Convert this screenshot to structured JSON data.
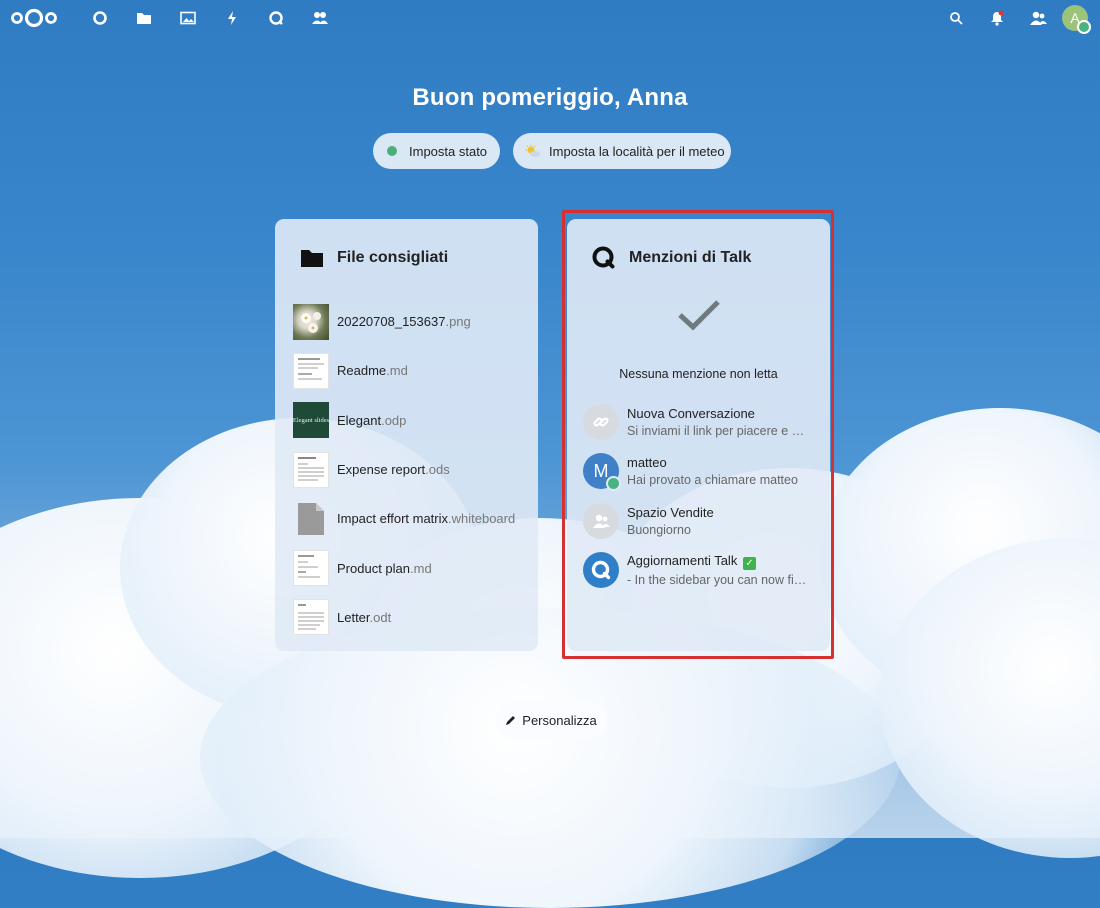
{
  "header": {
    "nav": [
      {
        "id": "dashboard",
        "icon": "dashboard-circle-icon"
      },
      {
        "id": "files",
        "icon": "folder-icon"
      },
      {
        "id": "photos",
        "icon": "image-icon"
      },
      {
        "id": "activity",
        "icon": "lightning-icon"
      },
      {
        "id": "talk",
        "icon": "talk-icon"
      },
      {
        "id": "contacts",
        "icon": "contacts-icon"
      }
    ],
    "right": [
      "search-icon",
      "notifications-icon",
      "contacts-menu-icon"
    ],
    "avatar_initial": "A"
  },
  "greeting": "Buon pomeriggio, Anna",
  "actions": {
    "status_label": "Imposta stato",
    "weather_label": "Imposta la località per il meteo"
  },
  "files_panel": {
    "title": "File consigliati",
    "files": [
      {
        "name": "20220708_153637",
        "ext": ".png"
      },
      {
        "name": "Readme",
        "ext": ".md"
      },
      {
        "name": "Elegant",
        "ext": ".odp"
      },
      {
        "name": "Expense report",
        "ext": ".ods"
      },
      {
        "name": "Impact effort matrix",
        "ext": ".whiteboard"
      },
      {
        "name": "Product plan",
        "ext": ".md"
      },
      {
        "name": "Letter",
        "ext": ".odt"
      }
    ],
    "elegant_thumb_text": "Elegant slides"
  },
  "talk_panel": {
    "title": "Menzioni di Talk",
    "empty_message": "Nessuna menzione non letta",
    "conversations": [
      {
        "name": "Nuova Conversazione",
        "preview": "Si inviami il link per piacere e …",
        "avatar": "link-icon"
      },
      {
        "name": "matteo",
        "preview": "Hai provato a chiamare matteo",
        "avatar_initial": "M",
        "online": true
      },
      {
        "name": "Spazio Vendite",
        "preview": "Buongiorno",
        "avatar": "group-icon"
      },
      {
        "name": "Aggiornamenti Talk",
        "badge": "✓",
        "preview": "- In the sidebar you can now fi…",
        "avatar": "talk-icon"
      }
    ]
  },
  "customize_label": "Personalizza",
  "colors": {
    "accent": "#3a86cc",
    "online": "#49b382",
    "highlight": "#d63030"
  }
}
